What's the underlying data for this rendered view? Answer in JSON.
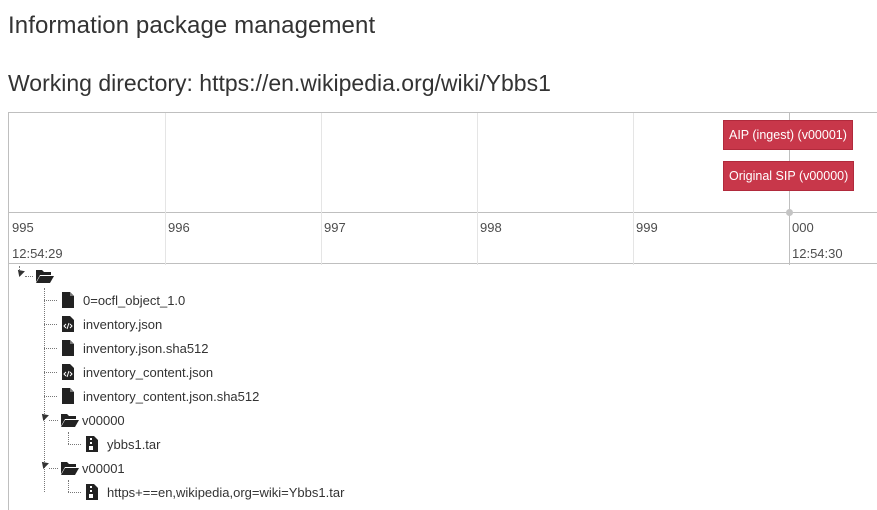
{
  "header": {
    "title": "Information package management",
    "working_directory": "Working directory: https://en.wikipedia.org/wiki/Ybbs1"
  },
  "timeline": {
    "items": [
      {
        "label": "AIP (ingest) (v00001)"
      },
      {
        "label": "Original SIP (v00000)"
      }
    ],
    "minor_labels": [
      "995",
      "996",
      "997",
      "998",
      "999",
      "000"
    ],
    "major_labels": [
      "12:54:29",
      "12:54:30"
    ]
  },
  "tree": {
    "root_icon": "folder-open-icon",
    "nodes": [
      {
        "label": "0=ocfl_object_1.0",
        "icon": "file-icon"
      },
      {
        "label": "inventory.json",
        "icon": "file-code-icon"
      },
      {
        "label": "inventory.json.sha512",
        "icon": "file-icon"
      },
      {
        "label": "inventory_content.json",
        "icon": "file-code-icon"
      },
      {
        "label": "inventory_content.json.sha512",
        "icon": "file-icon"
      },
      {
        "label": "v00000",
        "icon": "folder-open-icon",
        "children": [
          {
            "label": "ybbs1.tar",
            "icon": "file-archive-icon"
          }
        ]
      },
      {
        "label": "v00001",
        "icon": "folder-open-icon",
        "children": [
          {
            "label": "https+==en,wikipedia,org=wiki=Ybbs1.tar",
            "icon": "file-archive-icon"
          }
        ]
      }
    ]
  },
  "colors": {
    "timeline_item": "#c8374a",
    "text": "#333333",
    "border": "#bfbfbf"
  }
}
